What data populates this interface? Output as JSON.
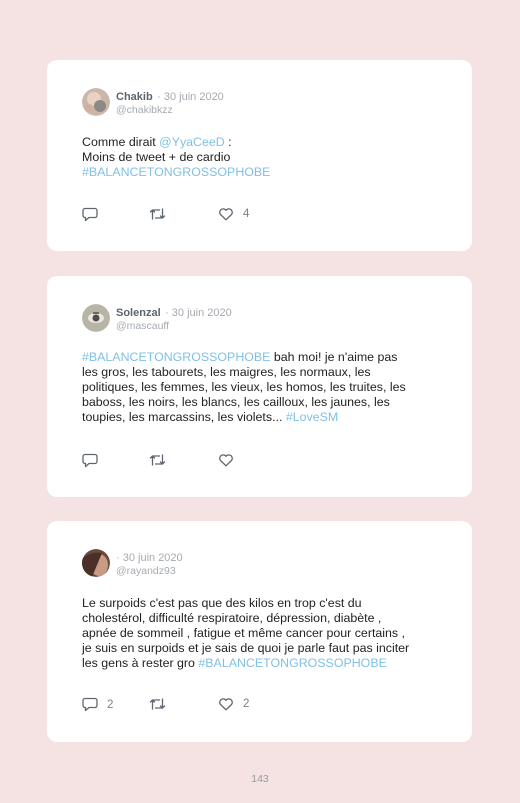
{
  "colors": {
    "background": "#f5e3e4",
    "link": "#7fc1e6",
    "muted": "#a5aab0"
  },
  "tweets": [
    {
      "name": "Chakib",
      "date": "· 30 juin 2020",
      "handle": "@chakibkzz",
      "text_parts": [
        {
          "t": "Comme dirait ",
          "link": false
        },
        {
          "t": "@YyaCeeD",
          "link": true
        },
        {
          "t": " :\nMoins de tweet + de cardio\n",
          "link": false
        },
        {
          "t": "#BALANCETONGROSSOPHOBE",
          "link": true
        }
      ],
      "reply_count": "",
      "retweet_count": "",
      "like_count": "4"
    },
    {
      "name": "Solenzal",
      "date": "· 30 juin 2020",
      "handle": "@mascauff",
      "text_parts": [
        {
          "t": "#BALANCETONGROSSOPHOBE",
          "link": true
        },
        {
          "t": " bah moi! je n'aime pas\nles gros, les tabourets, les maigres, les normaux, les\npolitiques, les femmes, les vieux, les homos, les truites, les\nbaboss, les noirs, les blancs, les cailloux, les jaunes, les\ntoupies, les marcassins, les violets... ",
          "link": false
        },
        {
          "t": "#LoveSM",
          "link": true
        }
      ],
      "reply_count": "",
      "retweet_count": "",
      "like_count": ""
    },
    {
      "name": "",
      "date": "· 30 juin 2020",
      "handle": "@rayandz93",
      "text_parts": [
        {
          "t": "Le surpoids c'est pas que des kilos en trop c'est du\ncholestérol, difficulté respiratoire, dépression, diabète ,\napnée de sommeil , fatigue et même cancer pour certains ,\nje suis en surpoids et je sais de quoi je parle faut pas inciter\nles gens à rester gro ",
          "link": false
        },
        {
          "t": "#BALANCETONGROSSOPHOBE",
          "link": true
        }
      ],
      "reply_count": "2",
      "retweet_count": "",
      "like_count": "2"
    }
  ],
  "page_number": "143"
}
